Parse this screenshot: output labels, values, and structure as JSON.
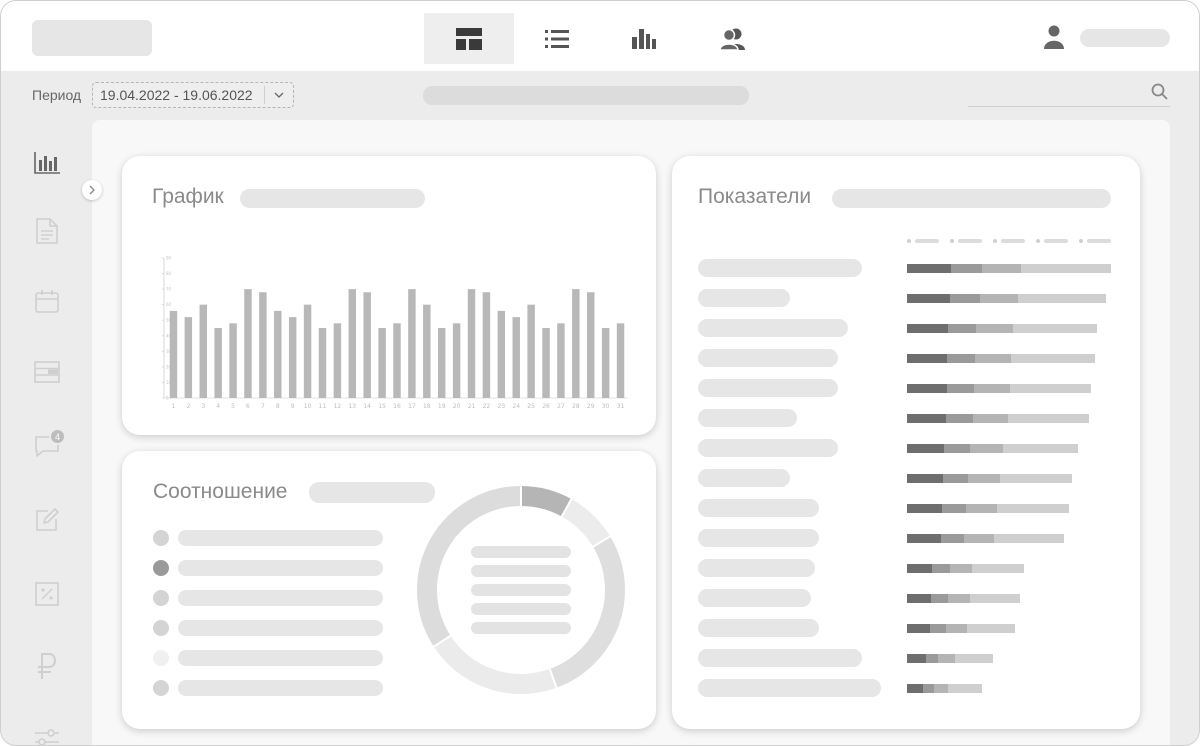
{
  "filter": {
    "period_label": "Период",
    "period_value": "19.04.2022 - 19.06.2022"
  },
  "nav": {
    "tabs": [
      {
        "icon": "dashboard-layout-icon",
        "active": true
      },
      {
        "icon": "list-icon",
        "active": false
      },
      {
        "icon": "bar-chart-icon",
        "active": false
      },
      {
        "icon": "users-icon",
        "active": false
      }
    ]
  },
  "sidebar": {
    "icons": [
      "bar-chart-icon",
      "document-icon",
      "calendar-icon",
      "table-icon",
      "chat-icon",
      "edit-icon",
      "percent-icon",
      "ruble-icon",
      "settings-sliders-icon"
    ],
    "chat_badge": "4"
  },
  "chart_card": {
    "title": "График"
  },
  "ratio_card": {
    "title": "Соотношение",
    "legend_colors": [
      "#d4d4d4",
      "#9a9a9a",
      "#d4d4d4",
      "#d4d4d4",
      "#f0f0f0",
      "#d4d4d4"
    ]
  },
  "metrics_card": {
    "title": "Показатели",
    "rows": [
      {
        "segments": [
          44,
          31,
          39,
          90
        ]
      },
      {
        "segments": [
          43,
          30,
          38,
          88
        ]
      },
      {
        "segments": [
          41,
          28,
          37,
          84
        ]
      },
      {
        "segments": [
          40,
          28,
          36,
          84
        ]
      },
      {
        "segments": [
          40,
          27,
          36,
          81
        ]
      },
      {
        "segments": [
          39,
          27,
          35,
          81
        ]
      },
      {
        "segments": [
          37,
          26,
          33,
          75
        ]
      },
      {
        "segments": [
          36,
          25,
          32,
          72
        ]
      },
      {
        "segments": [
          35,
          24,
          31,
          72
        ]
      },
      {
        "segments": [
          34,
          23,
          30,
          70
        ]
      },
      {
        "segments": [
          25,
          18,
          22,
          52
        ]
      },
      {
        "segments": [
          24,
          17,
          22,
          50
        ]
      },
      {
        "segments": [
          23,
          16,
          21,
          48
        ]
      },
      {
        "segments": [
          19,
          12,
          17,
          38
        ]
      },
      {
        "segments": [
          16,
          11,
          14,
          34
        ]
      }
    ],
    "segment_colors": [
      "#6e6e6e",
      "#9a9a9a",
      "#b4b4b4",
      "#cfcfcf"
    ]
  },
  "chart_data": {
    "type": "bar",
    "categories": [
      "1",
      "2",
      "3",
      "4",
      "5",
      "6",
      "7",
      "8",
      "9",
      "10",
      "11",
      "12",
      "13",
      "14",
      "15",
      "16",
      "17",
      "18",
      "19",
      "20",
      "21",
      "22",
      "23",
      "24",
      "25",
      "26",
      "27",
      "28",
      "29",
      "30",
      "31"
    ],
    "values": [
      56,
      52,
      60,
      45,
      48,
      70,
      68,
      56,
      52,
      60,
      45,
      48,
      70,
      68,
      45,
      48,
      70,
      60,
      45,
      48,
      70,
      68,
      56,
      52,
      60,
      45,
      48,
      70,
      68,
      45,
      48
    ],
    "ylim": [
      0,
      90
    ],
    "yticks": [
      0,
      10,
      20,
      30,
      40,
      50,
      60,
      70,
      80,
      90
    ],
    "bar_color": "#b8b8b8"
  }
}
